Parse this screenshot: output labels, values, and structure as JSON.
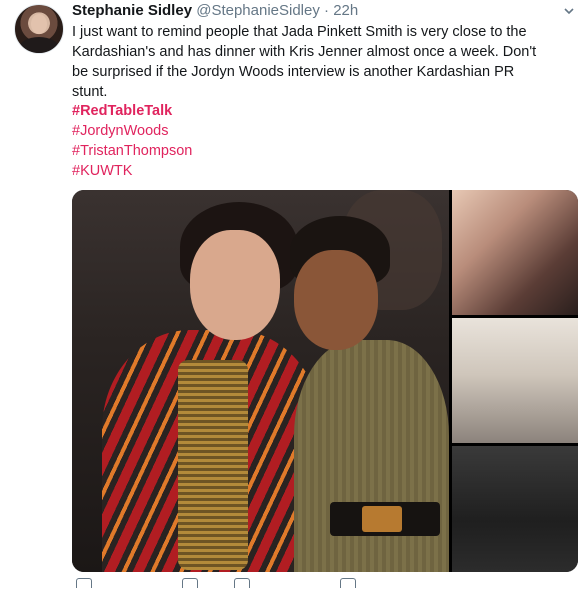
{
  "tweet": {
    "author_name": "Stephanie Sidley",
    "author_handle": "@StephanieSidley",
    "separator": "·",
    "time": "22h",
    "text": "I just want to remind people that Jada Pinkett Smith is very close to the Kardashian's and has dinner with Kris Jenner almost once a week. Don't be surprised if the Jordyn Woods interview is another Kardashian PR stunt.",
    "hashtags": [
      "#RedTableTalk",
      "#JordynWoods",
      "#TristanThompson",
      "#KUWTK"
    ]
  },
  "colors": {
    "hashtag": "#e0245e",
    "secondary_text": "#657786",
    "primary_text": "#14171a"
  },
  "icons": {
    "menu": "chevron-down-icon",
    "reply": "reply-icon",
    "retweet": "retweet-icon",
    "like": "like-icon",
    "share": "share-icon"
  }
}
